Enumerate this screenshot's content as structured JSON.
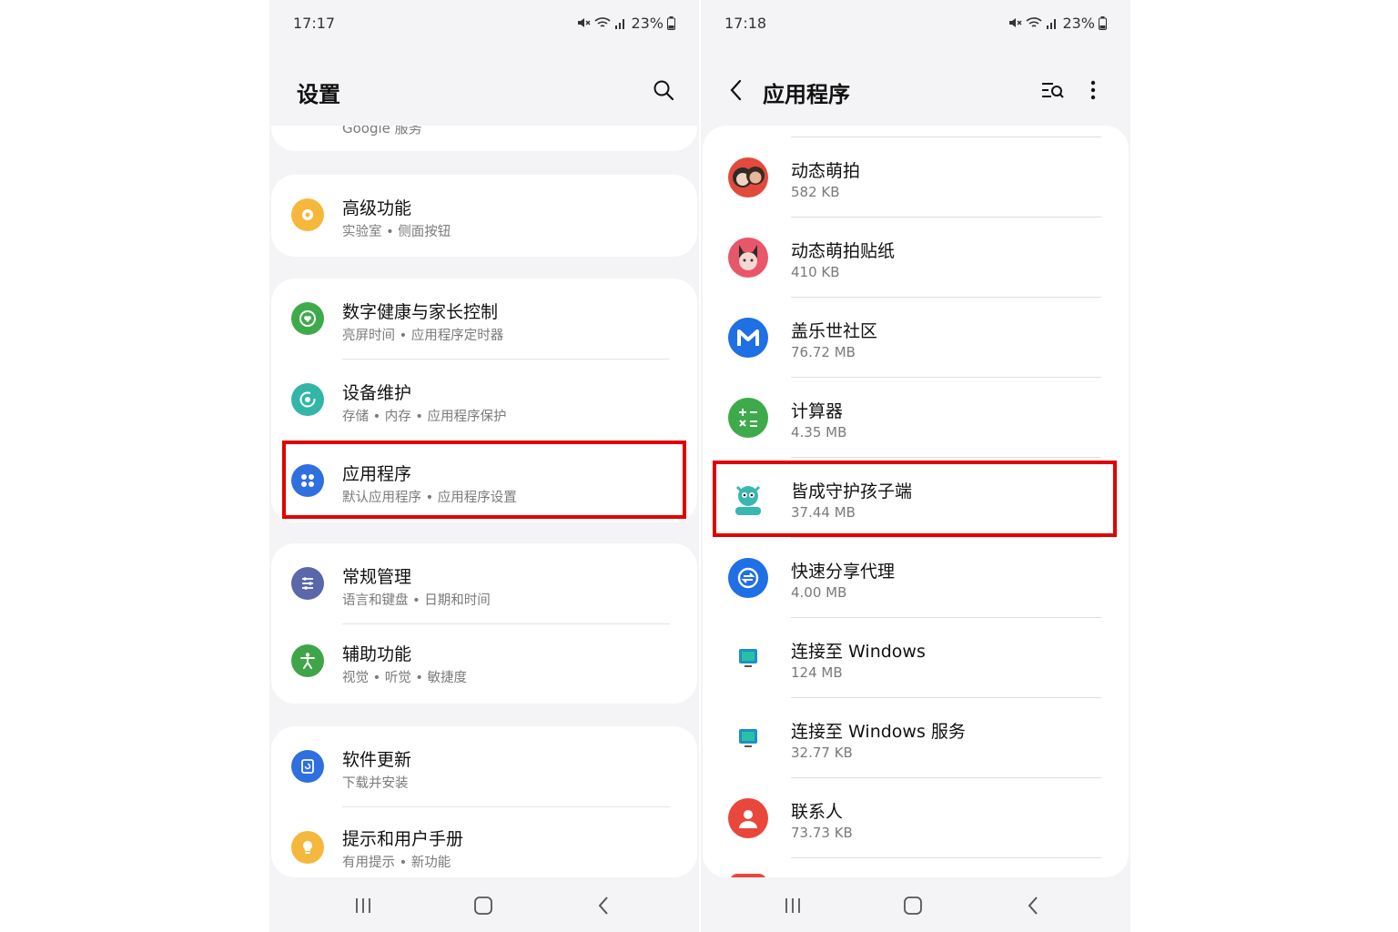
{
  "left_screen": {
    "status": {
      "time": "17:17",
      "battery": "23%"
    },
    "title": "设置",
    "partial_item_sub": "Google 服务",
    "items": [
      {
        "title": "高级功能",
        "sub": "实验室 • 侧面按钮"
      },
      {
        "title": "数字健康与家长控制",
        "sub": "亮屏时间 • 应用程序定时器"
      },
      {
        "title": "设备维护",
        "sub": "存储 • 内存 • 应用程序保护"
      },
      {
        "title": "应用程序",
        "sub": "默认应用程序 • 应用程序设置"
      },
      {
        "title": "常规管理",
        "sub": "语言和键盘 • 日期和时间"
      },
      {
        "title": "辅助功能",
        "sub": "视觉 • 听觉 • 敏捷度"
      },
      {
        "title": "软件更新",
        "sub": "下载并安装"
      },
      {
        "title": "提示和用户手册",
        "sub": "有用提示 • 新功能"
      }
    ]
  },
  "right_screen": {
    "status": {
      "time": "17:18",
      "battery": "23%"
    },
    "title": "应用程序",
    "apps": [
      {
        "name": "动态萌拍",
        "size": "582 KB"
      },
      {
        "name": "动态萌拍贴纸",
        "size": "410 KB"
      },
      {
        "name": "盖乐世社区",
        "size": "76.72 MB"
      },
      {
        "name": "计算器",
        "size": "4.35 MB"
      },
      {
        "name": "皆成守护孩子端",
        "size": "37.44 MB"
      },
      {
        "name": "快速分享代理",
        "size": "4.00 MB"
      },
      {
        "name": "连接至 Windows",
        "size": "124 MB"
      },
      {
        "name": "连接至 Windows 服务",
        "size": "32.77 KB"
      },
      {
        "name": "联系人",
        "size": "73.73 KB"
      }
    ]
  },
  "colors": {
    "highlight": "#e00000",
    "background": "#f4f4f6",
    "card": "#ffffff"
  }
}
